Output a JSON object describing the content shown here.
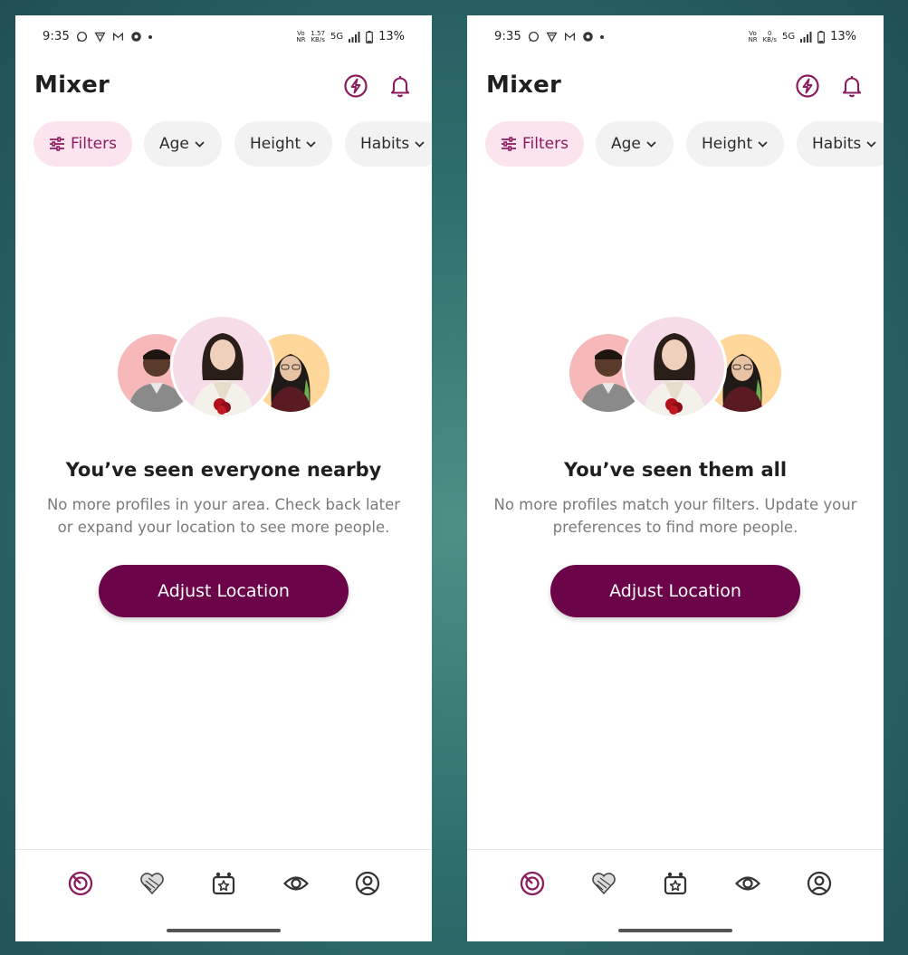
{
  "colors": {
    "brand": "#6b0449",
    "accent": "#8a1c5e",
    "chip_active_bg": "#fbe4ee",
    "chip_bg": "#f2f2f2",
    "page_bg": "#2f6e6b"
  },
  "screens": [
    {
      "status": {
        "time": "9:35",
        "speed_value": "1.57",
        "speed_unit": "KB/s",
        "network": "5G",
        "battery": "13%",
        "vonr": "Vo NR"
      },
      "app_title": "Mixer",
      "chips": {
        "filters": "Filters",
        "age": "Age",
        "height": "Height",
        "habits": "Habits"
      },
      "empty_state": {
        "title": "You’ve seen everyone nearby",
        "body": "No more profiles in your area. Check back later or expand your location to see more people."
      },
      "cta": "Adjust Location"
    },
    {
      "status": {
        "time": "9:35",
        "speed_value": "0",
        "speed_unit": "KB/s",
        "network": "5G",
        "battery": "13%",
        "vonr": "Vo NR"
      },
      "app_title": "Mixer",
      "chips": {
        "filters": "Filters",
        "age": "Age",
        "height": "Height",
        "habits": "Habits"
      },
      "empty_state": {
        "title": "You’ve seen them all",
        "body": "No more profiles match your filters. Update your preferences to find more people."
      },
      "cta": "Adjust Location"
    }
  ],
  "icons": {
    "top": [
      "bolt-icon",
      "bell-icon"
    ],
    "nav": [
      "discover-icon",
      "likes-icon",
      "mixer-icon",
      "views-icon",
      "profile-icon"
    ],
    "status": [
      "whatsapp-icon",
      "vpn-icon",
      "gmail-icon",
      "app-icon",
      "signal-icon",
      "battery-icon"
    ],
    "chip": [
      "sliders-icon",
      "chevron-down-icon"
    ]
  }
}
